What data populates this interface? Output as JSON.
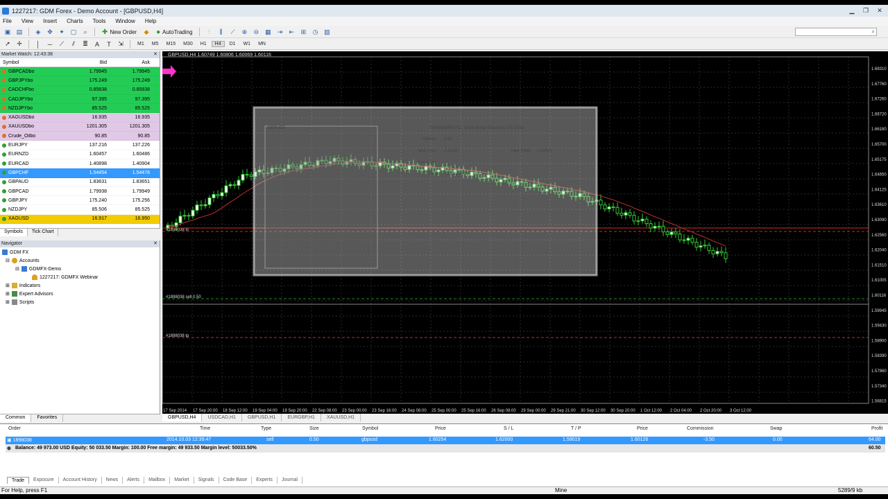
{
  "window": {
    "title": "1227217: GDM Forex - Demo Account - [GBPUSD,H4]"
  },
  "menu": [
    "File",
    "View",
    "Insert",
    "Charts",
    "Tools",
    "Window",
    "Help"
  ],
  "toolbar": {
    "new_order": "New Order",
    "autotrading": "AutoTrading"
  },
  "timeframes": [
    "M1",
    "M5",
    "M15",
    "M30",
    "H1",
    "H4",
    "D1",
    "W1",
    "MN"
  ],
  "active_timeframe": "H4",
  "market_watch": {
    "title": "Market Watch: 12:43:38",
    "headers": {
      "symbol": "Symbol",
      "bid": "Bid",
      "ask": "Ask"
    },
    "rows": [
      {
        "symbol": "GBPCADbo",
        "bid": "1.79945",
        "ask": "1.79945",
        "bg": "#22cc55",
        "dot": "#e07020"
      },
      {
        "symbol": "GBPJPYbo",
        "bid": "175.249",
        "ask": "175.249",
        "bg": "#22cc55",
        "dot": "#e07020"
      },
      {
        "symbol": "CADCHFbo",
        "bid": "0.85838",
        "ask": "0.85838",
        "bg": "#22cc55",
        "dot": "#e07020"
      },
      {
        "symbol": "CADJPYbo",
        "bid": "97.395",
        "ask": "97.395",
        "bg": "#22cc55",
        "dot": "#e07020"
      },
      {
        "symbol": "NZDJPYbo",
        "bid": "85.525",
        "ask": "85.525",
        "bg": "#22cc55",
        "dot": "#e07020"
      },
      {
        "symbol": "XAGUSDbo",
        "bid": "16.935",
        "ask": "16.935",
        "bg": "#e0c8e6",
        "dot": "#e07020"
      },
      {
        "symbol": "XAUUSDbo",
        "bid": "1201.305",
        "ask": "1201.305",
        "bg": "#e0c8e6",
        "dot": "#e07020"
      },
      {
        "symbol": "Crude_Oilbo",
        "bid": "90.85",
        "ask": "90.85",
        "bg": "#e0c8e6",
        "dot": "#e07020"
      },
      {
        "symbol": "EURJPY",
        "bid": "137.216",
        "ask": "137.226",
        "bg": "#ffffff",
        "dot": "#30a030"
      },
      {
        "symbol": "EURNZD",
        "bid": "1.60457",
        "ask": "1.60486",
        "bg": "#ffffff",
        "dot": "#30a030"
      },
      {
        "symbol": "EURCAD",
        "bid": "1.40898",
        "ask": "1.40904",
        "bg": "#ffffff",
        "dot": "#30a030"
      },
      {
        "symbol": "GBPCHF",
        "bid": "1.54454",
        "ask": "1.54478",
        "bg": "#3399ff",
        "dot": "#30a030"
      },
      {
        "symbol": "GBPAUD",
        "bid": "1.83631",
        "ask": "1.83651",
        "bg": "#ffffff",
        "dot": "#30a030"
      },
      {
        "symbol": "GBPCAD",
        "bid": "1.79938",
        "ask": "1.79949",
        "bg": "#ffffff",
        "dot": "#30a030"
      },
      {
        "symbol": "GBPJPY",
        "bid": "175.240",
        "ask": "175.256",
        "bg": "#ffffff",
        "dot": "#30a030"
      },
      {
        "symbol": "NZDJPY",
        "bid": "85.506",
        "ask": "85.525",
        "bg": "#ffffff",
        "dot": "#30a030"
      },
      {
        "symbol": "XAGUSD",
        "bid": "16.917",
        "ask": "16.950",
        "bg": "#f2cc00",
        "dot": "#30a030"
      }
    ],
    "tabs": [
      "Symbols",
      "Tick Chart"
    ]
  },
  "navigator": {
    "title": "Navigator",
    "root": "GDM FX",
    "accounts": "Accounts",
    "server": "GDMFX-Demo",
    "account": "1227217: GDMFX Webinar",
    "indicators": "Indicators",
    "experts": "Expert Advisors",
    "scripts": "Scripts",
    "tabs": [
      "Common",
      "Favorites"
    ]
  },
  "chart": {
    "header": "GBPUSD,H4  1.60749 1.60806 1.60069 1.60116",
    "price_labels": [
      "1.68310",
      "1.67760",
      "1.67260",
      "1.66720",
      "1.66180",
      "1.65700",
      "1.65175",
      "1.64650",
      "1.64125",
      "1.63610",
      "1.63090",
      "1.62560",
      "1.62040",
      "1.61510",
      "1.61005",
      "1.60116",
      "1.59945",
      "1.59430",
      "1.58900",
      "1.58390",
      "1.57860",
      "1.57340",
      "1.56815"
    ],
    "time_labels": [
      "17 Sep 2014",
      "17 Sep 20:00",
      "18 Sep 12:00",
      "19 Sep 04:00",
      "19 Sep 20:00",
      "22 Sep 08:00",
      "23 Sep 00:00",
      "23 Sep 16:00",
      "24 Sep 08:00",
      "25 Sep 00:00",
      "25 Sep 16:00",
      "26 Sep 08:00",
      "29 Sep 00:00",
      "29 Sep 21:00",
      "30 Sep 12:00",
      "30 Sep 20:00",
      "1 Oct 12:00",
      "2 Oct 04:00",
      "2 Oct 20:00",
      "3 Oct 12:00"
    ],
    "order_labels": [
      "#1898038 sl",
      "#1898038 sell 0.50",
      "#1898038 tp"
    ],
    "dialog": {
      "symbol_label": "Symbol:",
      "symbol": "GBPUSD, Great Britain Pound vs US Dollar",
      "volume_label": "Volume:",
      "volume": "0.50",
      "sl_label": "Stop Loss:",
      "sl": "1.61437",
      "tp_label": "Take Profit:",
      "tp": "1.59019",
      "comment_label": "Comment:",
      "type_label": "Type:",
      "type": "Modify Order",
      "mini_chart_title": "GBPUSD"
    },
    "tabs": [
      "GBPUSD,H4",
      "USDCAD,H1",
      "GBPUSD,H1",
      "EURGBP,H1",
      "XAUUSD,H1"
    ]
  },
  "terminal": {
    "headers": [
      "Order",
      "Time",
      "Type",
      "Size",
      "Symbol",
      "Price",
      "S / L",
      "T / P",
      "Price",
      "Commission",
      "Swap",
      "Profit"
    ],
    "order": {
      "id": "1898038",
      "time": "2014.10.03 12:39:47",
      "type": "sell",
      "size": "0.50",
      "symbol": "gbpusd",
      "price": "1.60254",
      "sl": "1.62000",
      "tp": "1.59019",
      "cur_price": "1.60126",
      "commission": "-3.50",
      "swap": "0.00",
      "profit": "64.00"
    },
    "balance": "Balance: 49 973.00 USD  Equity: 50 033.50  Margin: 100.00  Free margin: 49 933.50  Margin level: 50033.50%",
    "total_profit": "60.50",
    "tabs": [
      "Trade",
      "Exposure",
      "Account History",
      "News",
      "Alerts",
      "Mailbox",
      "Market",
      "Signals",
      "Code Base",
      "Experts",
      "Journal"
    ]
  },
  "status": {
    "help": "For Help, press F1",
    "profile": "Mine",
    "traffic": "5289/9 kb"
  }
}
